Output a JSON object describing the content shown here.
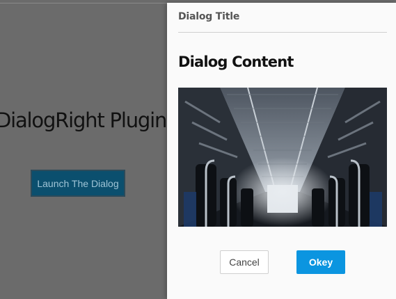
{
  "page": {
    "heading": "DialogRight Plugin Example",
    "launch_button_label": "Launch The Dialog"
  },
  "dialog": {
    "title": "Dialog Title",
    "content_heading": "Dialog Content",
    "image_alt": "Bus interior",
    "cancel_label": "Cancel",
    "okey_label": "Okey"
  },
  "colors": {
    "overlay": "#6b6b6b",
    "launch_button": "#0b4f6e",
    "primary_button": "#0b95e0",
    "dialog_background": "#fafafa"
  }
}
